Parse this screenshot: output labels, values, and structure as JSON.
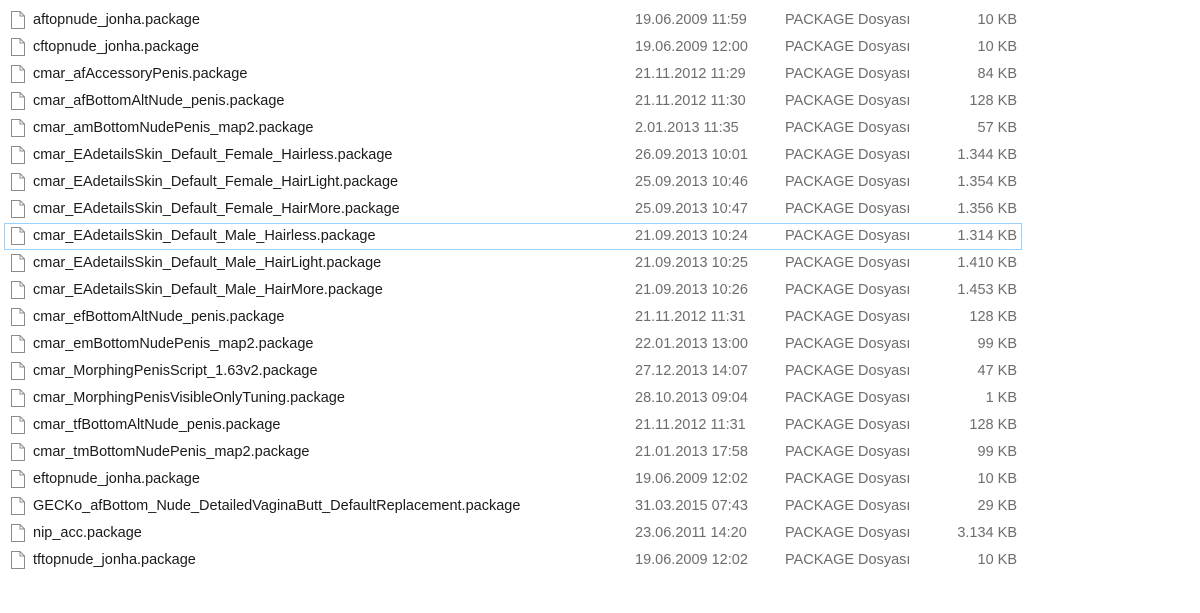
{
  "files": [
    {
      "icon": "file-icon",
      "name": "aftopnude_jonha.package",
      "date": "19.06.2009 11:59",
      "type": "PACKAGE Dosyası",
      "size": "10 KB"
    },
    {
      "icon": "file-icon",
      "name": "cftopnude_jonha.package",
      "date": "19.06.2009 12:00",
      "type": "PACKAGE Dosyası",
      "size": "10 KB"
    },
    {
      "icon": "file-icon",
      "name": "cmar_afAccessoryPenis.package",
      "date": "21.11.2012 11:29",
      "type": "PACKAGE Dosyası",
      "size": "84 KB"
    },
    {
      "icon": "file-icon",
      "name": "cmar_afBottomAltNude_penis.package",
      "date": "21.11.2012 11:30",
      "type": "PACKAGE Dosyası",
      "size": "128 KB"
    },
    {
      "icon": "file-icon",
      "name": "cmar_amBottomNudePenis_map2.package",
      "date": "2.01.2013 11:35",
      "type": "PACKAGE Dosyası",
      "size": "57 KB"
    },
    {
      "icon": "file-icon",
      "name": "cmar_EAdetailsSkin_Default_Female_Hairless.package",
      "date": "26.09.2013 10:01",
      "type": "PACKAGE Dosyası",
      "size": "1.344 KB"
    },
    {
      "icon": "file-icon",
      "name": "cmar_EAdetailsSkin_Default_Female_HairLight.package",
      "date": "25.09.2013 10:46",
      "type": "PACKAGE Dosyası",
      "size": "1.354 KB"
    },
    {
      "icon": "file-icon",
      "name": "cmar_EAdetailsSkin_Default_Female_HairMore.package",
      "date": "25.09.2013 10:47",
      "type": "PACKAGE Dosyası",
      "size": "1.356 KB"
    },
    {
      "icon": "file-icon",
      "name": "cmar_EAdetailsSkin_Default_Male_Hairless.package",
      "date": "21.09.2013 10:24",
      "type": "PACKAGE Dosyası",
      "size": "1.314 KB",
      "selected": true
    },
    {
      "icon": "file-icon",
      "name": "cmar_EAdetailsSkin_Default_Male_HairLight.package",
      "date": "21.09.2013 10:25",
      "type": "PACKAGE Dosyası",
      "size": "1.410 KB"
    },
    {
      "icon": "file-icon",
      "name": "cmar_EAdetailsSkin_Default_Male_HairMore.package",
      "date": "21.09.2013 10:26",
      "type": "PACKAGE Dosyası",
      "size": "1.453 KB"
    },
    {
      "icon": "file-icon",
      "name": "cmar_efBottomAltNude_penis.package",
      "date": "21.11.2012 11:31",
      "type": "PACKAGE Dosyası",
      "size": "128 KB"
    },
    {
      "icon": "file-icon",
      "name": "cmar_emBottomNudePenis_map2.package",
      "date": "22.01.2013 13:00",
      "type": "PACKAGE Dosyası",
      "size": "99 KB"
    },
    {
      "icon": "file-icon",
      "name": "cmar_MorphingPenisScript_1.63v2.package",
      "date": "27.12.2013 14:07",
      "type": "PACKAGE Dosyası",
      "size": "47 KB"
    },
    {
      "icon": "file-icon",
      "name": "cmar_MorphingPenisVisibleOnlyTuning.package",
      "date": "28.10.2013 09:04",
      "type": "PACKAGE Dosyası",
      "size": "1 KB"
    },
    {
      "icon": "file-icon",
      "name": "cmar_tfBottomAltNude_penis.package",
      "date": "21.11.2012 11:31",
      "type": "PACKAGE Dosyası",
      "size": "128 KB"
    },
    {
      "icon": "file-icon",
      "name": "cmar_tmBottomNudePenis_map2.package",
      "date": "21.01.2013 17:58",
      "type": "PACKAGE Dosyası",
      "size": "99 KB"
    },
    {
      "icon": "file-icon",
      "name": "eftopnude_jonha.package",
      "date": "19.06.2009 12:02",
      "type": "PACKAGE Dosyası",
      "size": "10 KB"
    },
    {
      "icon": "file-icon",
      "name": "GECKo_afBottom_Nude_DetailedVaginaButt_DefaultReplacement.package",
      "date": "31.03.2015 07:43",
      "type": "PACKAGE Dosyası",
      "size": "29 KB"
    },
    {
      "icon": "file-icon",
      "name": "nip_acc.package",
      "date": "23.06.2011 14:20",
      "type": "PACKAGE Dosyası",
      "size": "3.134 KB"
    },
    {
      "icon": "file-icon",
      "name": "tftopnude_jonha.package",
      "date": "19.06.2009 12:02",
      "type": "PACKAGE Dosyası",
      "size": "10 KB"
    }
  ],
  "colors": {
    "selection_border": "#99d1ff",
    "name_text": "#1a1a1a",
    "meta_text": "#6d6d6d"
  }
}
